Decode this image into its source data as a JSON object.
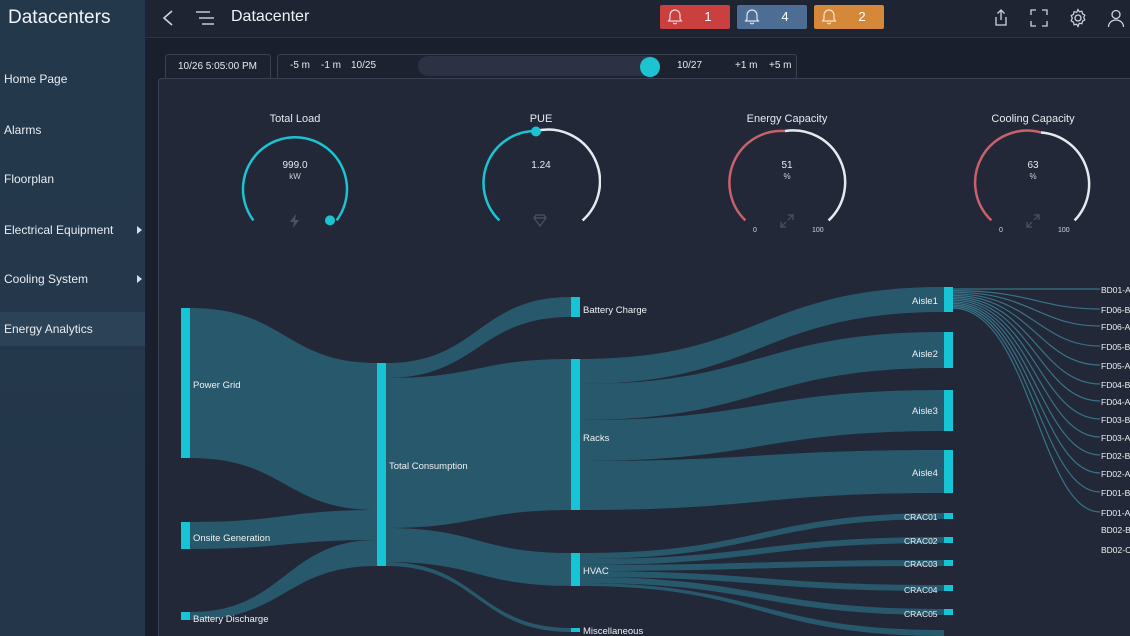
{
  "app": {
    "brand": "Datacenters",
    "page_title": "Datacenter"
  },
  "sidebar": {
    "items": [
      {
        "label": "Home Page",
        "has_children": false,
        "active": false
      },
      {
        "label": "Alarms",
        "has_children": false,
        "active": false
      },
      {
        "label": "Floorplan",
        "has_children": false,
        "active": false
      },
      {
        "label": "Electrical Equipment",
        "has_children": true,
        "active": false
      },
      {
        "label": "Cooling System",
        "has_children": true,
        "active": false
      },
      {
        "label": "Energy Analytics",
        "has_children": false,
        "active": true
      }
    ]
  },
  "alarms": [
    {
      "count": "1",
      "color": "#c9403f"
    },
    {
      "count": "4",
      "color": "#4e6d95"
    },
    {
      "count": "2",
      "color": "#d6883a"
    }
  ],
  "toolbar": {
    "icons": [
      "share-icon",
      "fullscreen-icon",
      "gear-icon",
      "user-icon"
    ]
  },
  "timebar": {
    "current": "10/26 5:05:00 PM",
    "minus5": "-5 m",
    "minus1": "-1 m",
    "start_date": "10/25",
    "end_date": "10/27",
    "plus1": "+1 m",
    "plus5": "+5 m"
  },
  "gauges": [
    {
      "title": "Total Load",
      "value": "999.0",
      "unit": "kW",
      "icon": "lightning-icon",
      "min": "",
      "max": ""
    },
    {
      "title": "PUE",
      "value": "1.24",
      "unit": "",
      "icon": "diamond-icon",
      "min": "",
      "max": ""
    },
    {
      "title": "Energy Capacity",
      "value": "51",
      "unit": "%",
      "icon": "expand-icon",
      "min": "0",
      "max": "100"
    },
    {
      "title": "Cooling Capacity",
      "value": "63",
      "unit": "%",
      "icon": "expand-icon",
      "min": "0",
      "max": "100"
    }
  ],
  "sankey": {
    "nodes": {
      "power_grid": "Power Grid",
      "onsite_generation": "Onsite Generation",
      "battery_discharge": "Battery Discharge",
      "total_consumption": "Total Consumption",
      "battery_charge": "Battery Charge",
      "racks": "Racks",
      "hvac": "HVAC",
      "miscellaneous": "Miscellaneous",
      "aisles": [
        "Aisle1",
        "Aisle2",
        "Aisle3",
        "Aisle4"
      ],
      "cracs": [
        "CRAC01",
        "CRAC02",
        "CRAC03",
        "CRAC04",
        "CRAC05"
      ]
    },
    "leaves": [
      "BD01-A",
      "FD06-B",
      "FD06-A",
      "FD05-B",
      "FD05-A",
      "FD04-B",
      "FD04-A",
      "FD03-B",
      "FD03-A",
      "FD02-B",
      "FD02-A",
      "FD01-B",
      "FD01-A",
      "BD02-B",
      "BD02-C"
    ],
    "colors": {
      "node": "#17c4d6",
      "link": "#2c6f86"
    }
  }
}
